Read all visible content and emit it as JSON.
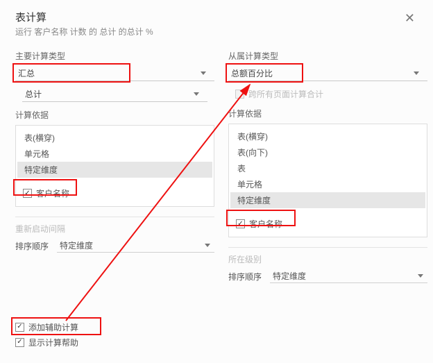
{
  "header": {
    "title": "表计算",
    "subtitle": "运行 客户名称 计数 的 总计 的总计 %",
    "close": "✕"
  },
  "primary": {
    "section_label": "主要计算类型",
    "main_select": "汇总",
    "sub_select": "总计",
    "basis_label": "计算依据",
    "list": [
      "表(横穿)",
      "单元格",
      "特定维度"
    ],
    "dim_check_label": "客户名称",
    "restart_label": "重新启动间隔",
    "sort_label": "排序顺序",
    "sort_value": "特定维度"
  },
  "secondary": {
    "section_label": "从属计算类型",
    "main_select": "总额百分比",
    "cross_pages_label": "跨所有页面计算合计",
    "basis_label": "计算依据",
    "list": [
      "表(横穿)",
      "表(向下)",
      "表",
      "单元格",
      "特定维度"
    ],
    "dim_check_label": "客户名称",
    "level_label": "所在级别",
    "sort_label": "排序顺序",
    "sort_value": "特定维度"
  },
  "footer": {
    "add_secondary": "添加辅助计算",
    "show_help": "显示计算帮助"
  }
}
